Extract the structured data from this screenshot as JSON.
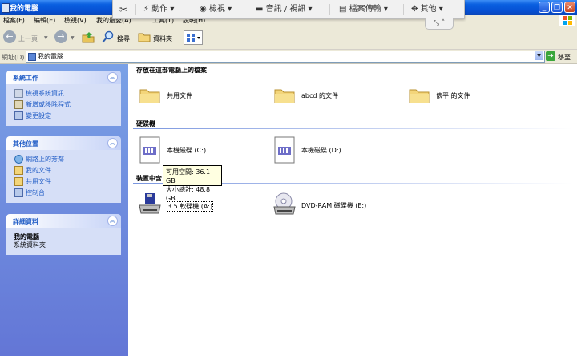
{
  "window": {
    "title": "我的電腦"
  },
  "remote_toolbar": {
    "items": [
      {
        "label": "動作"
      },
      {
        "label": "檢視"
      },
      {
        "label": "音訊 / 視訊"
      },
      {
        "label": "檔案傳輸"
      },
      {
        "label": "其他"
      }
    ]
  },
  "menu": [
    "檔案(F)",
    "編輯(E)",
    "檢視(V)",
    "我的最愛(A)",
    "工具(T)",
    "說明(H)"
  ],
  "toolbar": {
    "back": "上一頁",
    "search": "搜尋",
    "folders": "資料夾"
  },
  "address": {
    "label": "網址(D)",
    "value": "我的電腦",
    "go": "移至"
  },
  "sidebar": {
    "panels": [
      {
        "title": "系統工作",
        "items": [
          "檢視系統資訊",
          "新增或移除程式",
          "變更設定"
        ]
      },
      {
        "title": "其他位置",
        "items": [
          "網路上的芳鄰",
          "我的文件",
          "共用文件",
          "控制台"
        ]
      },
      {
        "title": "詳細資料",
        "details_title": "我的電腦",
        "details_sub": "系統資料夾"
      }
    ]
  },
  "main": {
    "groups": [
      {
        "title": "存放在這部電腦上的檔案",
        "items": [
          "共用文件",
          "abcd 的文件",
          "俵平 的文件"
        ]
      },
      {
        "title": "硬碟機",
        "items": [
          "本機磁碟 (C:)",
          "本機磁碟 (D:)"
        ]
      },
      {
        "title": "裝置中含",
        "items": [
          "3.5 軟碟機 (A:)",
          "DVD-RAM 磁碟機 (E:)"
        ]
      }
    ],
    "tooltip": {
      "line1": "可用空間: 36.1 GB",
      "line2": "大小總計: 48.8 GB"
    }
  }
}
